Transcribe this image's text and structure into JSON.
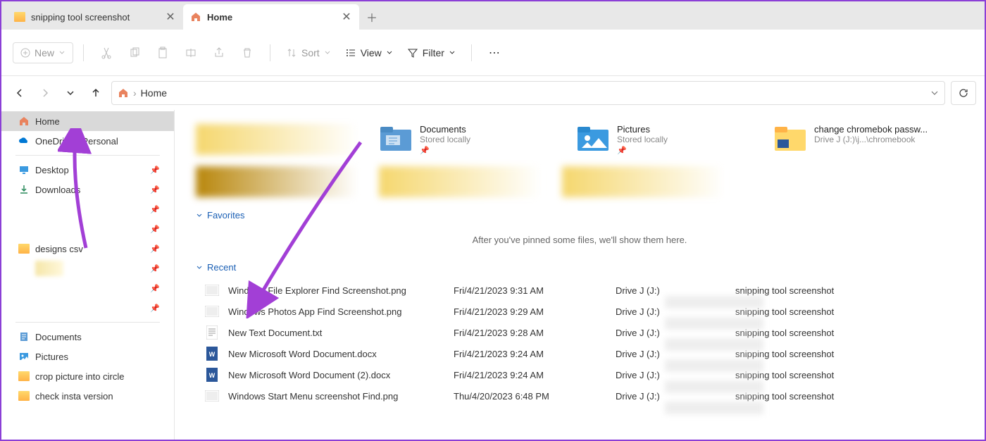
{
  "tabs": [
    {
      "title": "snipping tool screenshot",
      "active": false,
      "icon": "folder"
    },
    {
      "title": "Home",
      "active": true,
      "icon": "home"
    }
  ],
  "toolbar": {
    "new": "New",
    "sort": "Sort",
    "view": "View",
    "filter": "Filter"
  },
  "address": {
    "location": "Home"
  },
  "sidebar": {
    "home": "Home",
    "onedrive": "OneDrive - Personal",
    "desktop": "Desktop",
    "downloads": "Downloads",
    "designs": "designs csv",
    "documents": "Documents",
    "pictures": "Pictures",
    "crop": "crop picture into circle",
    "insta": "check insta version"
  },
  "tiles": [
    {
      "title": "Documents",
      "sub": "Stored locally",
      "pin": true,
      "icon": "docs"
    },
    {
      "title": "Pictures",
      "sub": "Stored locally",
      "pin": true,
      "icon": "pics"
    },
    {
      "title": "change chromebok passw...",
      "sub": "Drive J (J:)\\j...\\chromebook",
      "pin": false,
      "icon": "folder"
    }
  ],
  "sections": {
    "favorites": "Favorites",
    "favorites_empty": "After you've pinned some files, we'll show them here.",
    "recent": "Recent"
  },
  "recent": [
    {
      "icon": "png",
      "name": "Windows File Explorer Find Screenshot.png",
      "date": "Fri/4/21/2023 9:31 AM",
      "loc": "Drive J (J:)",
      "tag": "snipping tool screenshot"
    },
    {
      "icon": "png",
      "name": "Windows Photos App Find Screenshot.png",
      "date": "Fri/4/21/2023 9:29 AM",
      "loc": "Drive J (J:)",
      "tag": "snipping tool screenshot"
    },
    {
      "icon": "txt",
      "name": "New Text Document.txt",
      "date": "Fri/4/21/2023 9:28 AM",
      "loc": "Drive J (J:)",
      "tag": "snipping tool screenshot"
    },
    {
      "icon": "docx",
      "name": "New Microsoft Word Document.docx",
      "date": "Fri/4/21/2023 9:24 AM",
      "loc": "Drive J (J:)",
      "tag": "snipping tool screenshot"
    },
    {
      "icon": "docx",
      "name": "New Microsoft Word Document (2).docx",
      "date": "Fri/4/21/2023 9:24 AM",
      "loc": "Drive J (J:)",
      "tag": "snipping tool screenshot"
    },
    {
      "icon": "png",
      "name": "Windows Start Menu screenshot Find.png",
      "date": "Thu/4/20/2023 6:48 PM",
      "loc": "Drive J (J:)",
      "tag": "snipping tool screenshot"
    }
  ]
}
